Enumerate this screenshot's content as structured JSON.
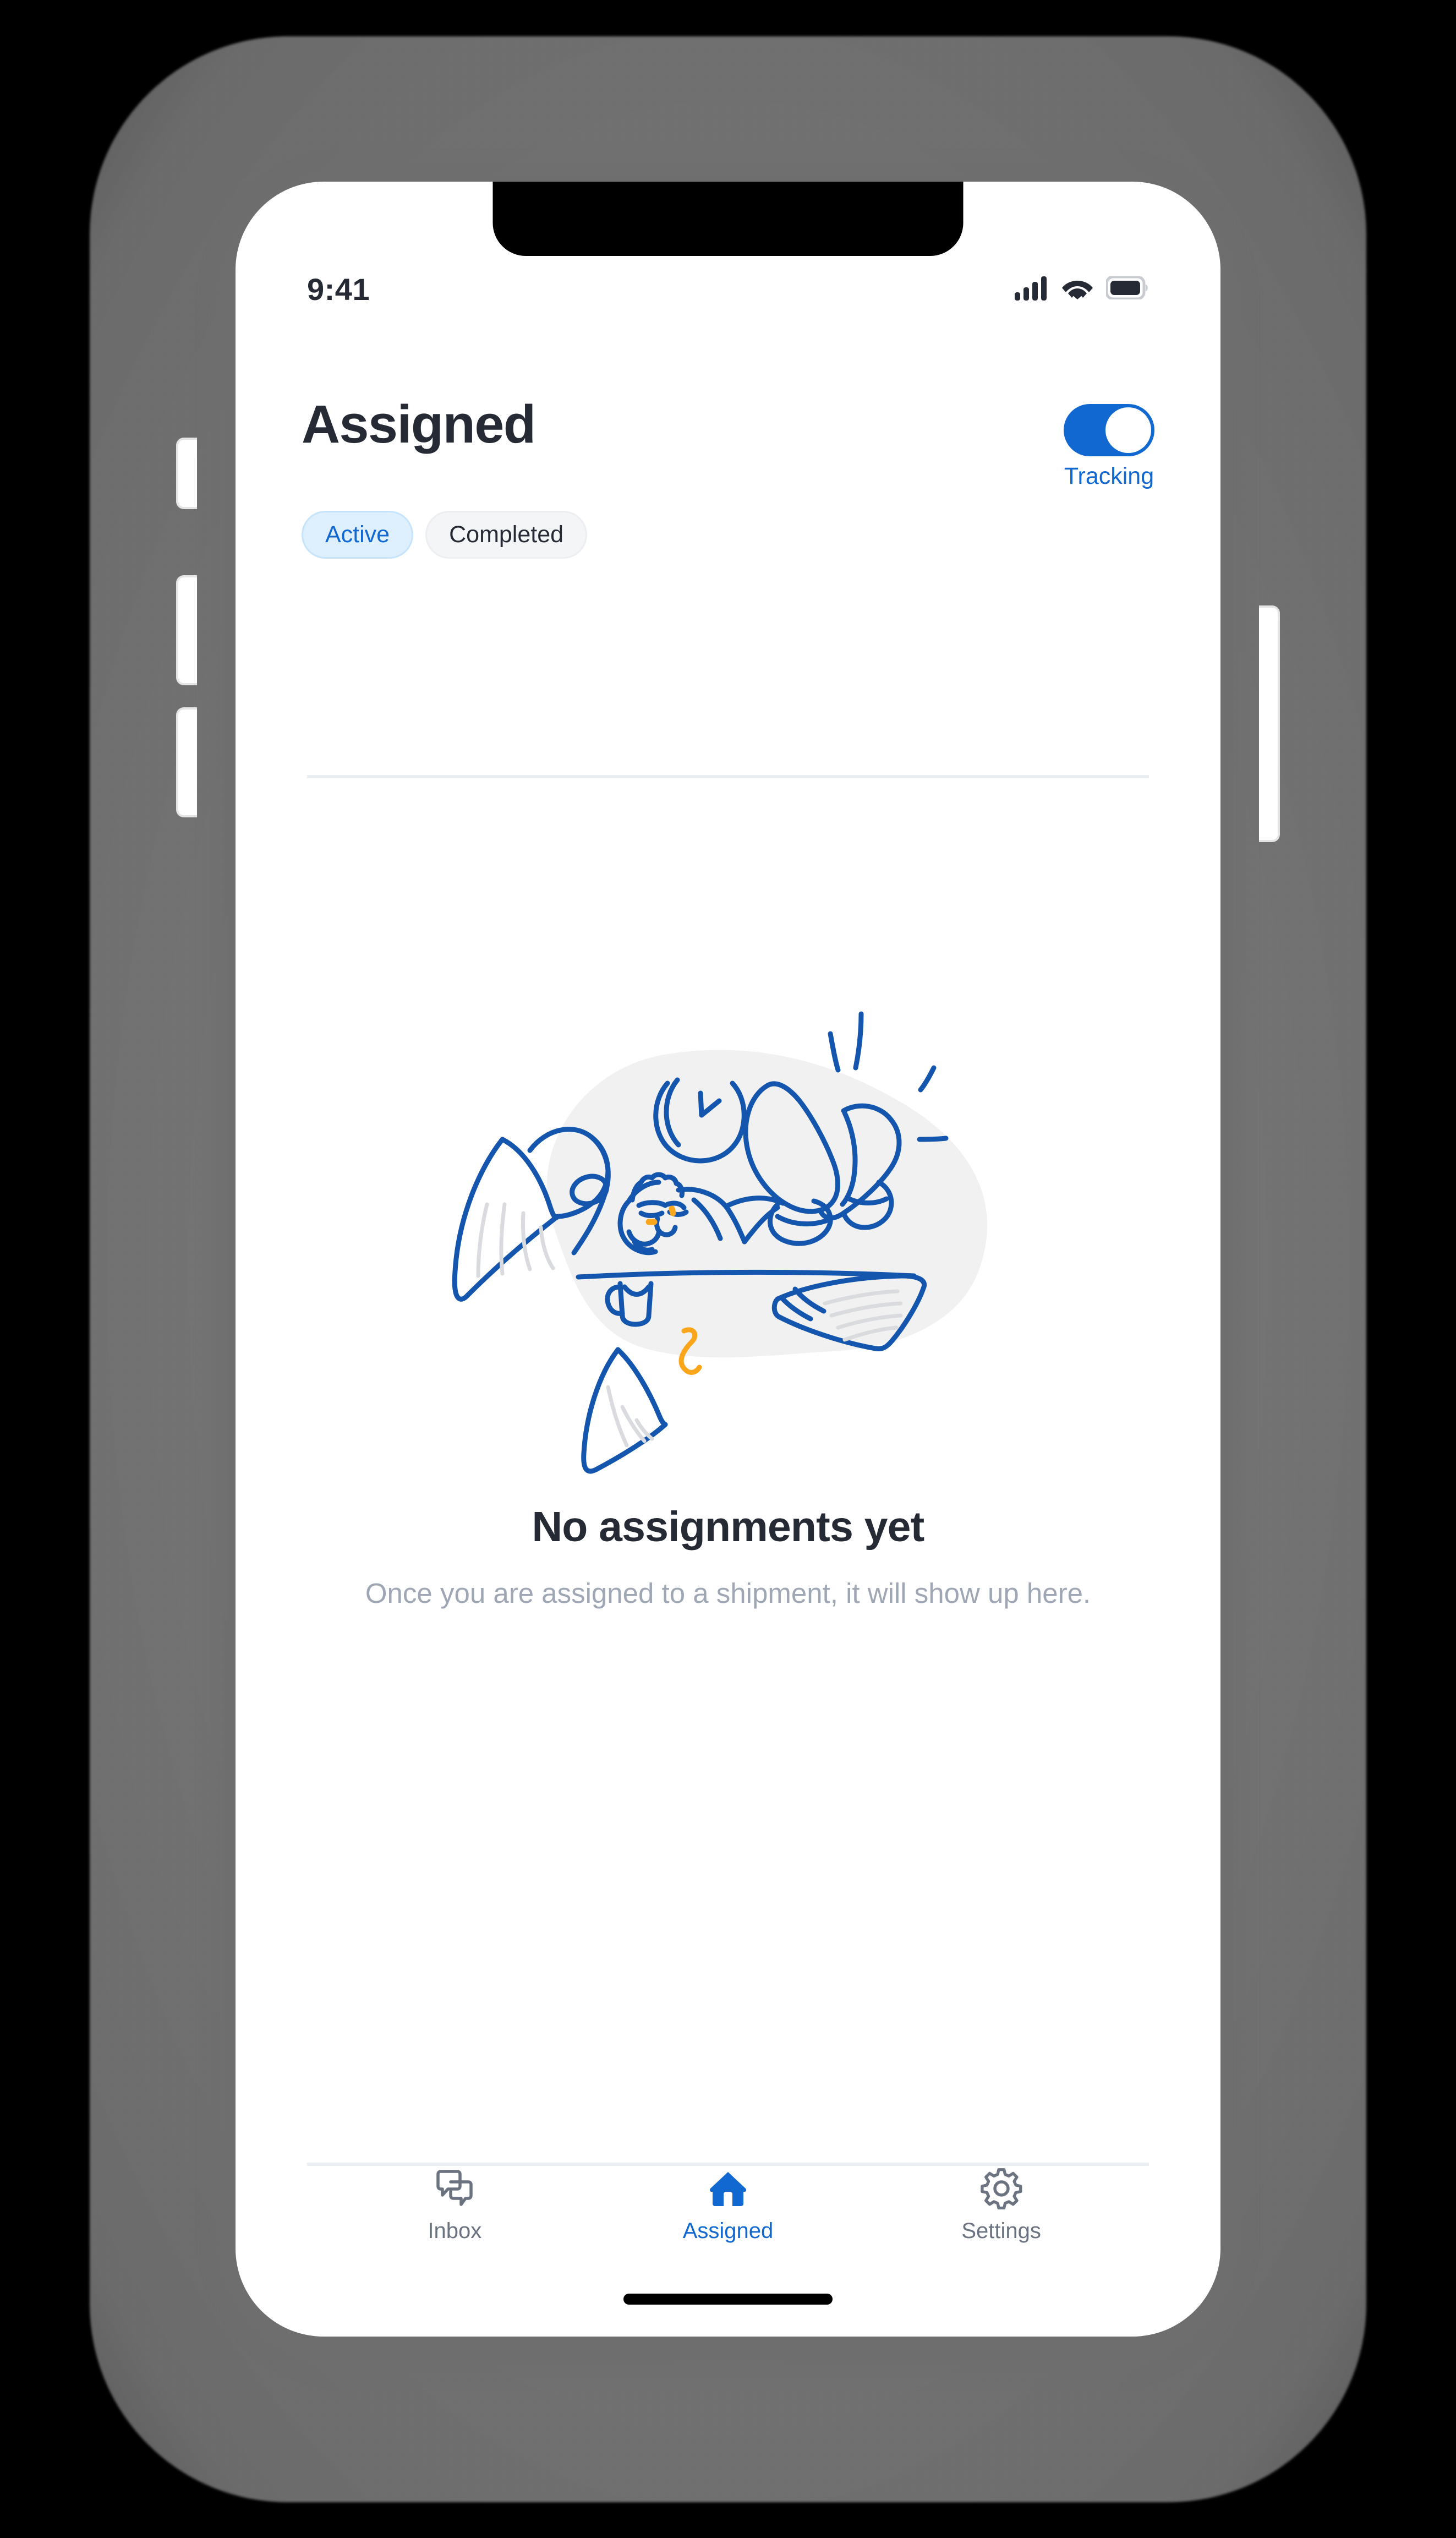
{
  "device": {
    "frame_color": "#6e6e6e",
    "buttons": [
      "silent-switch",
      "volume-up",
      "volume-down",
      "power"
    ]
  },
  "status_bar": {
    "time": "9:41",
    "icons": [
      "cellular-signal-icon",
      "wifi-icon",
      "battery-icon"
    ],
    "battery_full": true,
    "signal_bars": 4,
    "text_color": "#252A34"
  },
  "header": {
    "title": "Assigned",
    "tracking": {
      "label": "Tracking",
      "enabled": true,
      "on_color": "#1268D1"
    },
    "tabs": [
      {
        "label": "Active",
        "selected": true
      },
      {
        "label": "Completed",
        "selected": false
      }
    ]
  },
  "empty_state": {
    "illustration_name": "person-relaxing-feet-on-desk-illustration",
    "title": "No assignments yet",
    "subtitle": "Once you are assigned to a shipment, it will show up here.",
    "title_color": "#252A34",
    "subtitle_color": "#A0A7B4",
    "illustration_line_color": "#1455AD",
    "illustration_blob_color": "#F1F1F1",
    "illustration_accent_color": "#FBA51A"
  },
  "bottom_nav": {
    "items": [
      {
        "label": "Inbox",
        "icon": "chat-bubbles-icon",
        "active": false
      },
      {
        "label": "Assigned",
        "icon": "home-icon",
        "active": true
      },
      {
        "label": "Settings",
        "icon": "gear-icon",
        "active": false
      }
    ],
    "active_color": "#1268D1",
    "inactive_color": "#6B7280"
  },
  "theme": {
    "accent": "#1268D1",
    "surface": "#ffffff",
    "divider": "#EBEEF2",
    "tab_active_bg": "#DEEFFD",
    "tab_inactive_bg": "#F4F5F7"
  }
}
